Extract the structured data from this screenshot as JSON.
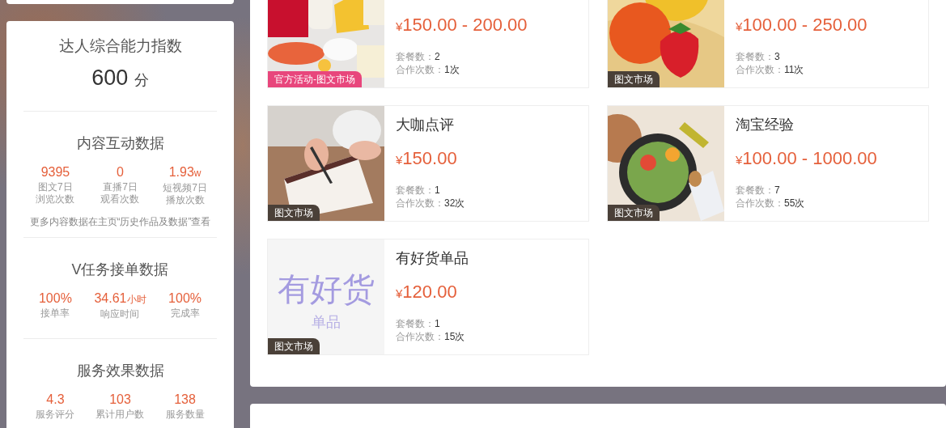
{
  "ability": {
    "title": "达人综合能力指数",
    "score": "600",
    "unit": "分"
  },
  "sections": [
    {
      "title": "内容互动数据",
      "stats": [
        {
          "value": "9395",
          "label_lines": [
            "图文7日",
            "浏览次数"
          ]
        },
        {
          "value": "0",
          "label_lines": [
            "直播7日",
            "观看次数"
          ]
        },
        {
          "value": "1.93",
          "unit": "w",
          "label_lines": [
            "短视频7日",
            "播放次数"
          ]
        }
      ],
      "note": "更多内容数据在主页“历史作品及数据”查看"
    },
    {
      "title": "V任务接单数据",
      "stats": [
        {
          "value": "100%",
          "label_lines": [
            "接单率"
          ]
        },
        {
          "value": "34.61",
          "unit": "小时",
          "label_lines": [
            "响应时间"
          ]
        },
        {
          "value": "100%",
          "label_lines": [
            "完成率"
          ]
        }
      ]
    },
    {
      "title": "服务效果数据",
      "stats": [
        {
          "value": "4.3",
          "label_lines": [
            "服务评分"
          ]
        },
        {
          "value": "103",
          "label_lines": [
            "累计用户数"
          ]
        },
        {
          "value": "138",
          "label_lines": [
            "服务数量"
          ]
        }
      ]
    }
  ],
  "products": [
    {
      "image": {
        "kind": "picture"
      },
      "badge": {
        "text": "官方活动-图文市场",
        "color": "#e8467c"
      },
      "currency": "¥",
      "price": "150.00 - 200.00",
      "meta": [
        {
          "label": "套餐数：",
          "value": "2"
        },
        {
          "label": "合作次数：",
          "value": "1次"
        }
      ]
    },
    {
      "image": {
        "kind": "picture"
      },
      "badge": {
        "text": "图文市场",
        "color": "#4a4038"
      },
      "currency": "¥",
      "price": "100.00 - 250.00",
      "meta": [
        {
          "label": "套餐数：",
          "value": "3"
        },
        {
          "label": "合作次数：",
          "value": "11次"
        }
      ]
    },
    {
      "title": "大咖点评",
      "image": {
        "kind": "picture"
      },
      "badge": {
        "text": "图文市场",
        "color": "#4a4038"
      },
      "currency": "¥",
      "price": "150.00",
      "meta": [
        {
          "label": "套餐数：",
          "value": "1"
        },
        {
          "label": "合作次数：",
          "value": "32次"
        }
      ]
    },
    {
      "title": "淘宝经验",
      "image": {
        "kind": "picture"
      },
      "badge": {
        "text": "图文市场",
        "color": "#4a4038"
      },
      "currency": "¥",
      "price": "100.00 - 1000.00",
      "meta": [
        {
          "label": "套餐数：",
          "value": "7"
        },
        {
          "label": "合作次数：",
          "value": "55次"
        }
      ]
    },
    {
      "title": "有好货单品",
      "image": {
        "kind": "text",
        "lines": [
          "有好货",
          "单品"
        ]
      },
      "badge": {
        "text": "图文市场",
        "color": "#4a4038"
      },
      "currency": "¥",
      "price": "120.00",
      "meta": [
        {
          "label": "套餐数：",
          "value": "1"
        },
        {
          "label": "合作次数：",
          "value": "15次"
        }
      ]
    }
  ]
}
